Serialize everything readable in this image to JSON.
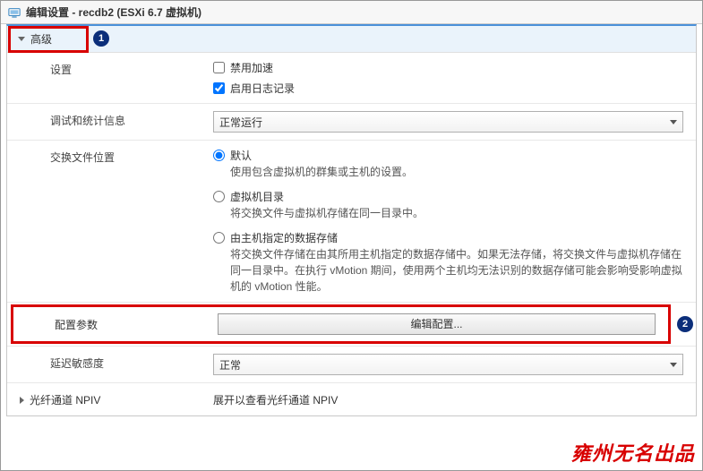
{
  "title": "编辑设置 - recdb2 (ESXi 6.7 虚拟机)",
  "section": {
    "advanced": "高级"
  },
  "rows": {
    "settings": {
      "label": "设置",
      "disable_accel": {
        "label": "禁用加速",
        "checked": false
      },
      "enable_logging": {
        "label": "启用日志记录",
        "checked": true
      }
    },
    "debug_stats": {
      "label": "调试和统计信息",
      "value": "正常运行"
    },
    "swap_location": {
      "label": "交换文件位置",
      "opt_default": {
        "label": "默认",
        "desc": "使用包含虚拟机的群集或主机的设置。"
      },
      "opt_vmdir": {
        "label": "虚拟机目录",
        "desc": "将交换文件与虚拟机存储在同一目录中。"
      },
      "opt_host": {
        "label": "由主机指定的数据存储",
        "desc": "将交换文件存储在由其所用主机指定的数据存储中。如果无法存储，将交换文件与虚拟机存储在同一目录中。在执行 vMotion 期间，使用两个主机均无法识别的数据存储可能会影响受影响虚拟机的 vMotion 性能。"
      },
      "selected": "default"
    },
    "config_params": {
      "label": "配置参数",
      "button": "编辑配置..."
    },
    "latency": {
      "label": "延迟敏感度",
      "value": "正常"
    },
    "npiv": {
      "label": "光纤通道 NPIV",
      "desc": "展开以查看光纤通道 NPIV"
    }
  },
  "callouts": {
    "one": "1",
    "two": "2"
  },
  "watermark": "雍州无名出品"
}
